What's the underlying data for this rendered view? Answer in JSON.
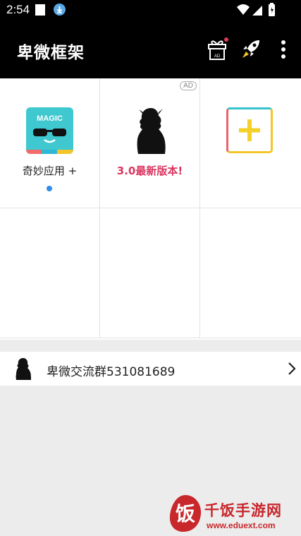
{
  "status_bar": {
    "time": "2:54"
  },
  "toolbar": {
    "title": "卑微框架",
    "gift_badge_text": "AD",
    "icons": [
      "gift-icon",
      "rocket-icon",
      "more-vert-icon"
    ]
  },
  "grid": {
    "cells": [
      {
        "label": "奇妙应用 +",
        "icon": "magic-app-icon",
        "icon_text": "MAGIC"
      },
      {
        "label": "3.0最新版本!",
        "icon": "silhouette-icon",
        "badge": "AD"
      },
      {
        "icon": "add-icon"
      }
    ]
  },
  "group_row": {
    "label": "卑微交流群531081689",
    "icon": "silhouette-avatar-icon"
  },
  "watermark": {
    "brand": "千饭手游网",
    "url": "www.eduext.com",
    "logo_char": "饭"
  },
  "colors": {
    "accent_red": "#d9365f",
    "dot_blue": "#2f8ee8",
    "teal": "#3fc8cf",
    "yellow": "#f4c52a"
  }
}
